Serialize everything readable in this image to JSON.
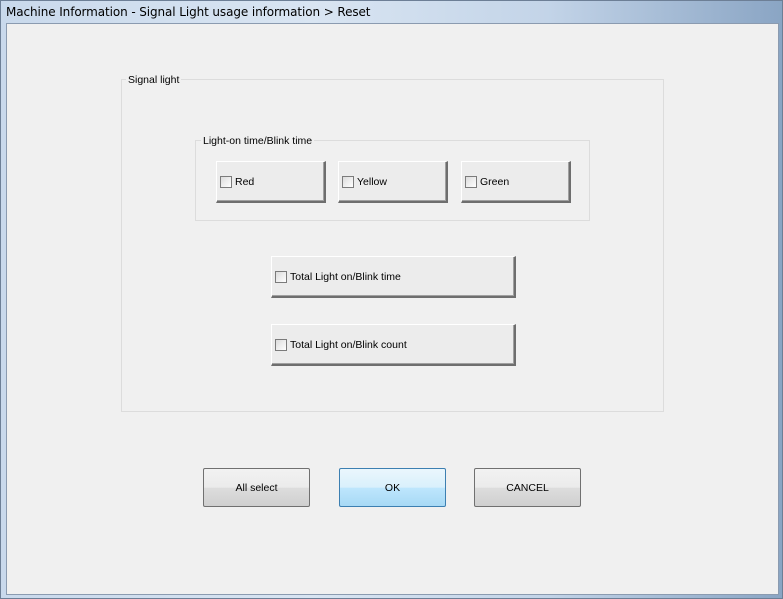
{
  "window": {
    "title": "Machine Information - Signal Light usage information > Reset"
  },
  "signal_light_group": {
    "label": "Signal light",
    "light_group": {
      "label": "Light-on time/Blink time",
      "items": [
        {
          "label": "Red",
          "checked": false
        },
        {
          "label": "Yellow",
          "checked": false
        },
        {
          "label": "Green",
          "checked": false
        }
      ]
    },
    "total_time": {
      "label": "Total Light on/Blink time",
      "checked": false
    },
    "total_count": {
      "label": "Total Light on/Blink count",
      "checked": false
    }
  },
  "buttons": {
    "all_select": "All select",
    "ok": "OK",
    "cancel": "CANCEL"
  }
}
